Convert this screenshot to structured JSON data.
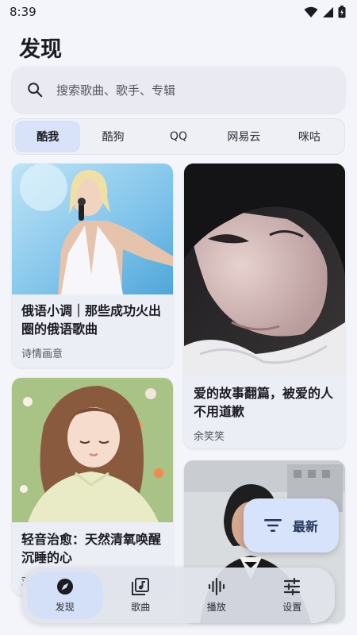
{
  "status_bar": {
    "time": "8:39"
  },
  "page": {
    "title": "发现"
  },
  "search": {
    "placeholder": "搜索歌曲、歌手、专辑"
  },
  "tabs": [
    {
      "label": "酷我",
      "active": true
    },
    {
      "label": "酷狗"
    },
    {
      "label": "QQ"
    },
    {
      "label": "网易云"
    },
    {
      "label": "咪咕"
    }
  ],
  "cards": [
    {
      "title": "俄语小调｜那些成功火出圈的俄语歌曲",
      "subtitle": "诗情画意"
    },
    {
      "title": "爱的故事翻篇，被爱的人不用道歉",
      "subtitle": "余笑笑"
    },
    {
      "title": "轻音治愈：天然清氧唤醒沉睡的心",
      "subtitle": "观"
    }
  ],
  "fab": {
    "label": "最新",
    "icon": "filter-icon"
  },
  "bottom_nav": [
    {
      "label": "发现",
      "icon": "compass-icon",
      "active": true
    },
    {
      "label": "歌曲",
      "icon": "music-library-icon"
    },
    {
      "label": "播放",
      "icon": "waveform-icon"
    },
    {
      "label": "设置",
      "icon": "sliders-icon"
    }
  ],
  "colors": {
    "background": "#f4f4fb",
    "accent": "#d8e2f8",
    "text": "#1b1b21"
  }
}
